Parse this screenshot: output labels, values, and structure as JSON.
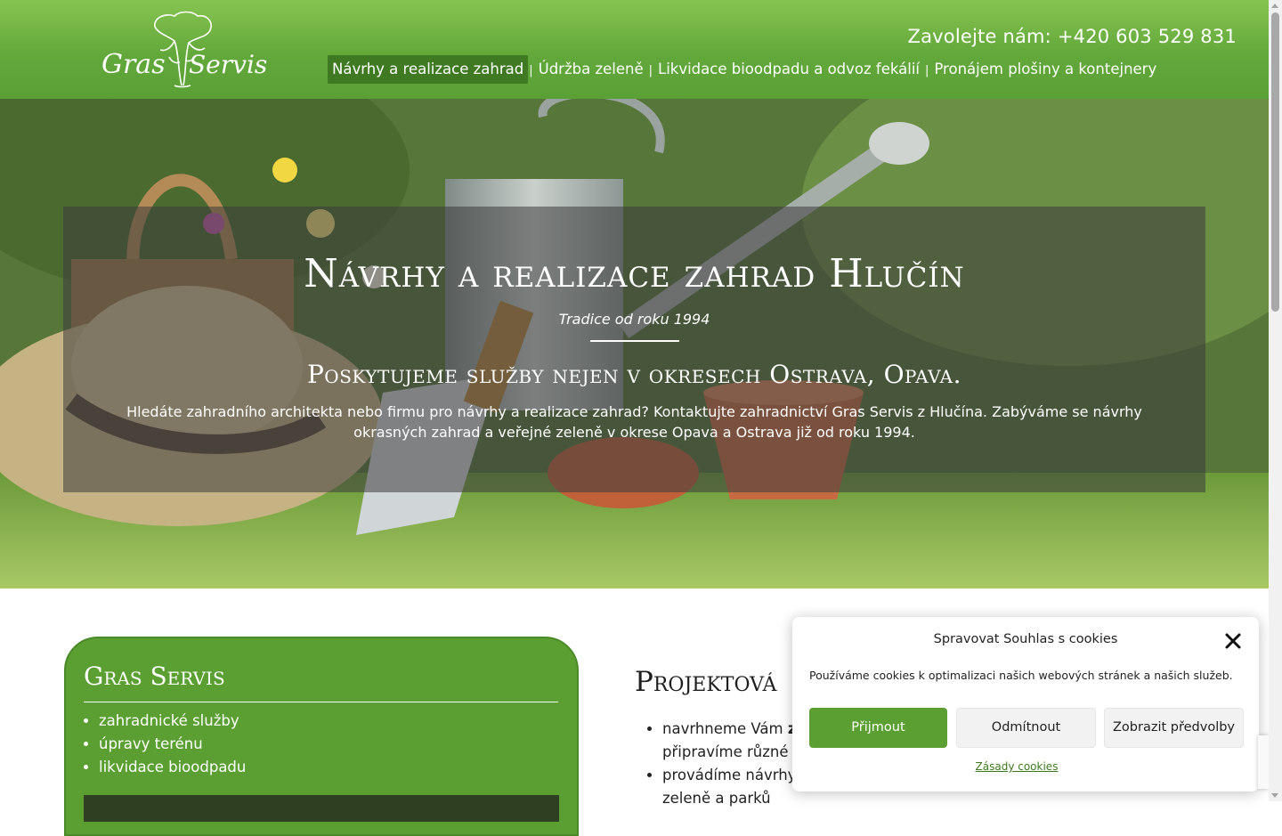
{
  "header": {
    "logo_text": "Gras Servis",
    "phone": "Zavolejte nám: +420 603 529 831",
    "nav": [
      {
        "label": "Návrhy a realizace zahrad",
        "active": true
      },
      {
        "label": "Údržba zeleně",
        "active": false
      },
      {
        "label": "Likvidace bioodpadu a odvoz fekálií",
        "active": false
      },
      {
        "label": "Pronájem plošiny a kontejnery",
        "active": false
      }
    ],
    "separator": "|"
  },
  "hero": {
    "title": "Návrhy a realizace zahrad Hlučín",
    "subtitle": "Tradice od roku 1994",
    "heading": "Poskytujeme služby nejen v okresech Ostrava, Opava.",
    "text": "Hledáte zahradního architekta nebo firmu pro návrhy a realizace zahrad? Kontaktujte zahradnictví Gras Servis z Hlučína. Zabýváme se návrhy okrasných zahrad a veřejné zeleně v okrese Opava a Ostrava již od roku 1994."
  },
  "sidebar_card": {
    "title": "Gras Servis",
    "items": [
      "zahradnické služby",
      "úpravy terénu",
      "likvidace bioodpadu"
    ]
  },
  "content": {
    "title": "Projektová",
    "list": [
      {
        "text": "navrhneme Vám z",
        "bold_part": "z",
        "line2": "připravíme různé v"
      },
      {
        "text": "provádíme návrhy",
        "line2": "zeleně a parků"
      }
    ]
  },
  "cookie_dialog": {
    "title": "Spravovat Souhlas s cookies",
    "text": "Používáme cookies k optimalizaci našich webových stránek a našich služeb.",
    "accept": "Přijmout",
    "deny": "Odmítnout",
    "preferences": "Zobrazit předvolby",
    "policy_link": "Zásady cookies"
  },
  "colors": {
    "header_green": "#63a83b",
    "nav_active": "#3f7a23",
    "card_green": "#5b9f33",
    "accept_button": "#5b9f33"
  }
}
